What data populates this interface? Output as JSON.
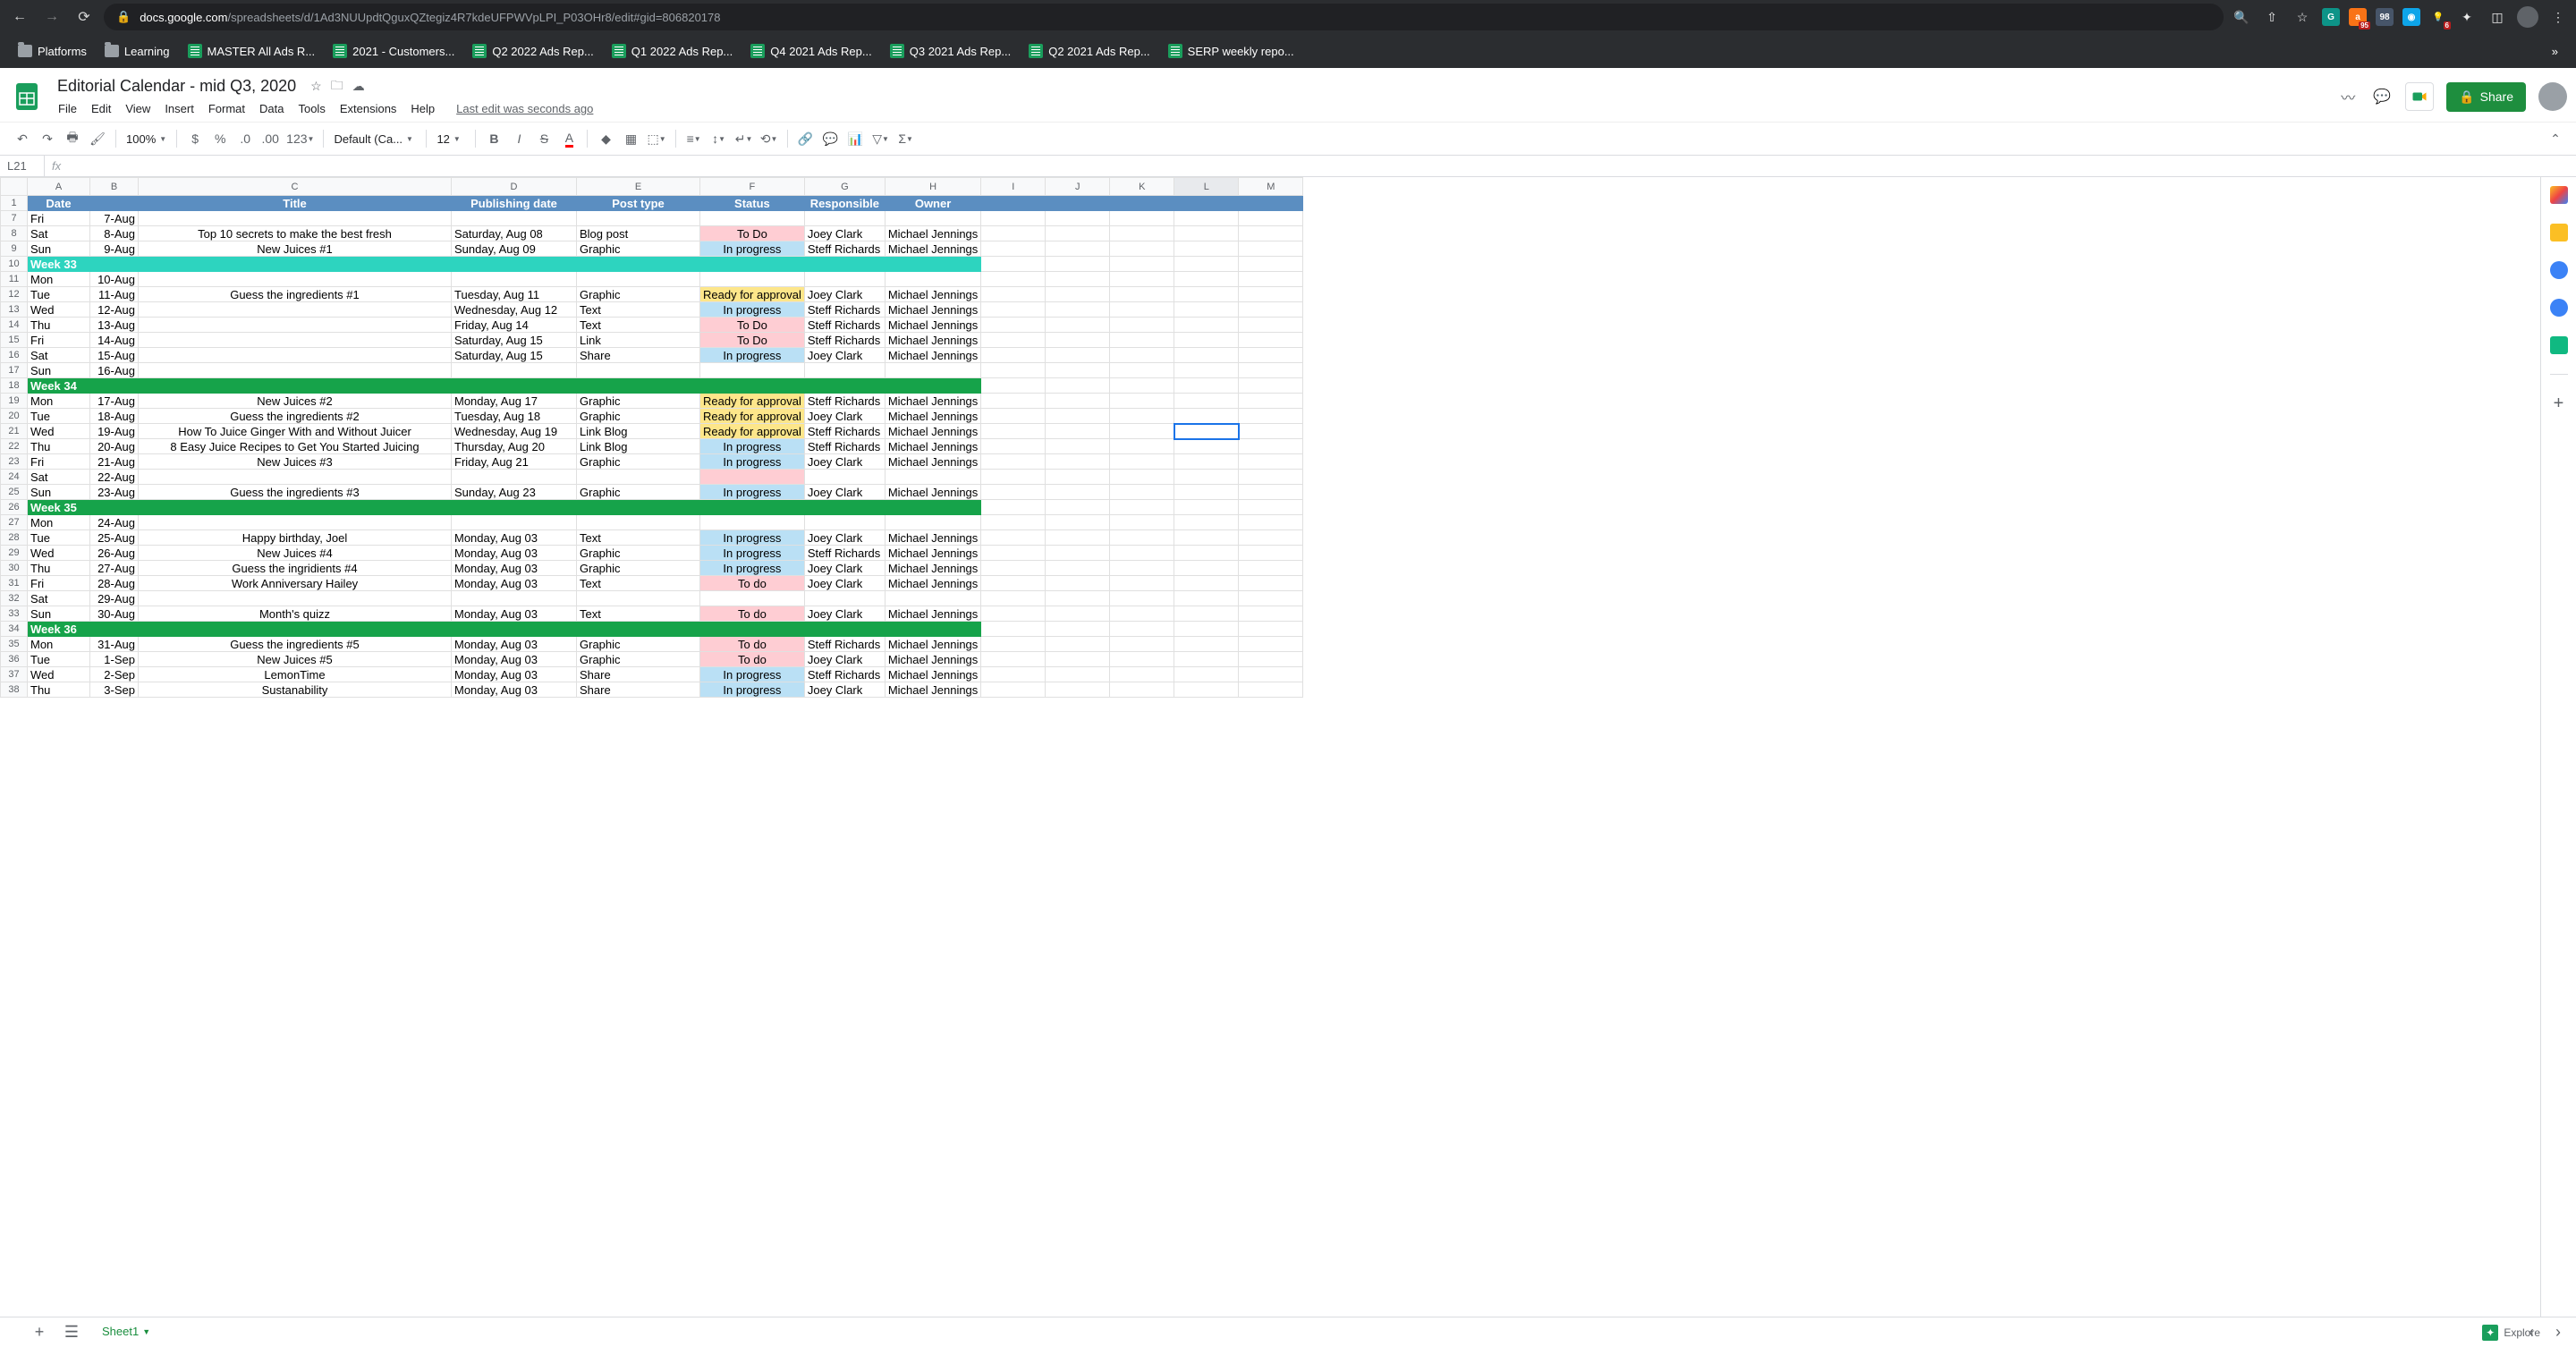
{
  "browser": {
    "url_prefix": "docs.google.com",
    "url_rest": "/spreadsheets/d/1Ad3NUUpdtQguxQZtegiz4R7kdeUFPWVpLPI_P03OHr8/edit#gid=806820178",
    "bookmarks": [
      {
        "label": "Platforms",
        "type": "folder"
      },
      {
        "label": "Learning",
        "type": "folder"
      },
      {
        "label": "MASTER All Ads R...",
        "type": "sheets"
      },
      {
        "label": "2021 - Customers...",
        "type": "sheets"
      },
      {
        "label": "Q2 2022 Ads Rep...",
        "type": "sheets"
      },
      {
        "label": "Q1 2022 Ads Rep...",
        "type": "sheets"
      },
      {
        "label": "Q4 2021 Ads Rep...",
        "type": "sheets"
      },
      {
        "label": "Q3 2021 Ads Rep...",
        "type": "sheets"
      },
      {
        "label": "Q2 2021 Ads Rep...",
        "type": "sheets"
      },
      {
        "label": "SERP weekly repo...",
        "type": "sheets"
      }
    ],
    "ext_badge1": "95",
    "ext_badge2": "98",
    "ext_badge3": "6"
  },
  "doc": {
    "title": "Editorial Calendar - mid Q3, 2020",
    "menus": [
      "File",
      "Edit",
      "View",
      "Insert",
      "Format",
      "Data",
      "Tools",
      "Extensions",
      "Help"
    ],
    "last_edit": "Last edit was seconds ago",
    "share": "Share"
  },
  "toolbar": {
    "zoom": "100%",
    "font": "Default (Ca...",
    "size": "12"
  },
  "name_box": "L21",
  "columns": [
    "A",
    "B",
    "C",
    "D",
    "E",
    "F",
    "G",
    "H",
    "I",
    "J",
    "K",
    "L",
    "M"
  ],
  "headers": {
    "A": "Date",
    "B": "",
    "C": "Title",
    "D": "Publishing date",
    "E": "Post type",
    "F": "Status",
    "G": "Responsible",
    "H": "Owner"
  },
  "rows": [
    {
      "n": 1,
      "type": "header"
    },
    {
      "n": 7,
      "A": "Fri",
      "B": "7-Aug"
    },
    {
      "n": 8,
      "A": "Sat",
      "B": "8-Aug",
      "C": "Top 10 secrets to make the best fresh",
      "D": "Saturday, Aug 08",
      "E": "Blog post",
      "F": "To Do",
      "Fc": "status-todo",
      "G": "Joey Clark",
      "H": "Michael Jennings"
    },
    {
      "n": 9,
      "A": "Sun",
      "B": "9-Aug",
      "C": "New Juices #1",
      "D": "Sunday, Aug 09",
      "E": "Graphic",
      "F": "In progress",
      "Fc": "status-progress",
      "G": "Steff Richards",
      "H": "Michael Jennings"
    },
    {
      "n": 10,
      "type": "week",
      "label": "Week 33",
      "hl": true
    },
    {
      "n": 11,
      "A": "Mon",
      "B": "10-Aug"
    },
    {
      "n": 12,
      "A": "Tue",
      "B": "11-Aug",
      "C": "Guess the ingredients #1",
      "D": "Tuesday, Aug 11",
      "E": "Graphic",
      "F": "Ready for approval",
      "Fc": "status-ready",
      "G": "Joey Clark",
      "H": "Michael Jennings"
    },
    {
      "n": 13,
      "A": "Wed",
      "B": "12-Aug",
      "D": "Wednesday, Aug 12",
      "E": "Text",
      "F": "In progress",
      "Fc": "status-progress",
      "G": "Steff Richards",
      "H": "Michael Jennings"
    },
    {
      "n": 14,
      "A": "Thu",
      "B": "13-Aug",
      "D": "Friday, Aug 14",
      "E": "Text",
      "F": "To Do",
      "Fc": "status-todo",
      "G": "Steff Richards",
      "H": "Michael Jennings"
    },
    {
      "n": 15,
      "A": "Fri",
      "B": "14-Aug",
      "D": "Saturday, Aug 15",
      "E": "Link",
      "F": "To Do",
      "Fc": "status-todo",
      "G": "Steff Richards",
      "H": "Michael Jennings"
    },
    {
      "n": 16,
      "A": "Sat",
      "B": "15-Aug",
      "D": "Saturday, Aug 15",
      "E": "Share",
      "F": "In progress",
      "Fc": "status-progress",
      "G": "Joey Clark",
      "H": "Michael Jennings"
    },
    {
      "n": 17,
      "A": "Sun",
      "B": "16-Aug"
    },
    {
      "n": 18,
      "type": "week",
      "label": "Week 34"
    },
    {
      "n": 19,
      "A": "Mon",
      "B": "17-Aug",
      "C": "New Juices #2",
      "D": "Monday, Aug 17",
      "E": "Graphic",
      "F": "Ready for approval",
      "Fc": "status-ready",
      "G": "Steff Richards",
      "H": "Michael Jennings"
    },
    {
      "n": 20,
      "A": "Tue",
      "B": "18-Aug",
      "C": "Guess the ingredients #2",
      "D": "Tuesday, Aug 18",
      "E": "Graphic",
      "F": "Ready for approval",
      "Fc": "status-ready",
      "G": "Joey Clark",
      "H": "Michael Jennings"
    },
    {
      "n": 21,
      "A": "Wed",
      "B": "19-Aug",
      "C": "How To Juice Ginger With and Without Juicer",
      "D": "Wednesday, Aug 19",
      "E": "Link Blog",
      "F": "Ready for approval",
      "Fc": "status-ready",
      "G": "Steff Richards",
      "H": "Michael Jennings"
    },
    {
      "n": 22,
      "A": "Thu",
      "B": "20-Aug",
      "C": "8 Easy Juice Recipes to Get You Started Juicing",
      "D": "Thursday, Aug 20",
      "E": "Link Blog",
      "F": "In progress",
      "Fc": "status-progress",
      "G": "Steff Richards",
      "H": "Michael Jennings"
    },
    {
      "n": 23,
      "A": "Fri",
      "B": "21-Aug",
      "C": "New Juices #3",
      "D": "Friday, Aug 21",
      "E": "Graphic",
      "F": "In progress",
      "Fc": "status-progress",
      "G": "Joey Clark",
      "H": "Michael Jennings"
    },
    {
      "n": 24,
      "A": "Sat",
      "B": "22-Aug",
      "F": "",
      "Fc": "status-empty-pink"
    },
    {
      "n": 25,
      "A": "Sun",
      "B": "23-Aug",
      "C": "Guess the ingredients #3",
      "D": "Sunday, Aug 23",
      "E": "Graphic",
      "F": "In progress",
      "Fc": "status-progress",
      "G": "Joey Clark",
      "H": "Michael Jennings"
    },
    {
      "n": 26,
      "type": "week",
      "label": "Week 35"
    },
    {
      "n": 27,
      "A": "Mon",
      "B": "24-Aug"
    },
    {
      "n": 28,
      "A": "Tue",
      "B": "25-Aug",
      "C": "Happy birthday, Joel",
      "D": "Monday, Aug 03",
      "E": "Text",
      "F": "In progress",
      "Fc": "status-progress",
      "G": "Joey Clark",
      "H": "Michael Jennings"
    },
    {
      "n": 29,
      "A": "Wed",
      "B": "26-Aug",
      "C": "New Juices #4",
      "D": "Monday, Aug 03",
      "E": "Graphic",
      "F": "In progress",
      "Fc": "status-progress",
      "G": "Steff Richards",
      "H": "Michael Jennings"
    },
    {
      "n": 30,
      "A": "Thu",
      "B": "27-Aug",
      "C": "Guess the ingridients #4",
      "D": "Monday, Aug 03",
      "E": "Graphic",
      "F": "In progress",
      "Fc": "status-progress",
      "G": "Joey Clark",
      "H": "Michael Jennings"
    },
    {
      "n": 31,
      "A": "Fri",
      "B": "28-Aug",
      "C": "Work Anniversary Hailey",
      "D": "Monday, Aug 03",
      "E": "Text",
      "F": "To do",
      "Fc": "status-todo",
      "G": "Joey Clark",
      "H": "Michael Jennings"
    },
    {
      "n": 32,
      "A": "Sat",
      "B": "29-Aug"
    },
    {
      "n": 33,
      "A": "Sun",
      "B": "30-Aug",
      "C": "Month's quizz",
      "D": "Monday, Aug 03",
      "E": "Text",
      "F": "To do",
      "Fc": "status-todo",
      "G": "Joey Clark",
      "H": "Michael Jennings"
    },
    {
      "n": 34,
      "type": "week",
      "label": "Week 36"
    },
    {
      "n": 35,
      "A": "Mon",
      "B": "31-Aug",
      "C": "Guess the ingredients #5",
      "D": "Monday, Aug 03",
      "E": "Graphic",
      "F": "To do",
      "Fc": "status-todo",
      "G": "Steff Richards",
      "H": "Michael Jennings"
    },
    {
      "n": 36,
      "A": "Tue",
      "B": "1-Sep",
      "C": "New Juices #5",
      "D": "Monday, Aug 03",
      "E": "Graphic",
      "F": "To do",
      "Fc": "status-todo",
      "G": "Joey Clark",
      "H": "Michael Jennings"
    },
    {
      "n": 37,
      "A": "Wed",
      "B": "2-Sep",
      "C": "LemonTime",
      "D": "Monday, Aug 03",
      "E": "Share",
      "F": "In progress",
      "Fc": "status-progress",
      "G": "Steff Richards",
      "H": "Michael Jennings"
    },
    {
      "n": 38,
      "A": "Thu",
      "B": "3-Sep",
      "C": "Sustanability",
      "D": "Monday, Aug 03",
      "E": "Share",
      "F": "In progress",
      "Fc": "status-progress",
      "G": "Joey Clark",
      "H": "Michael Jennings"
    }
  ],
  "sheet_tab": "Sheet1",
  "explore": "Explore",
  "selected_cell": "L21"
}
